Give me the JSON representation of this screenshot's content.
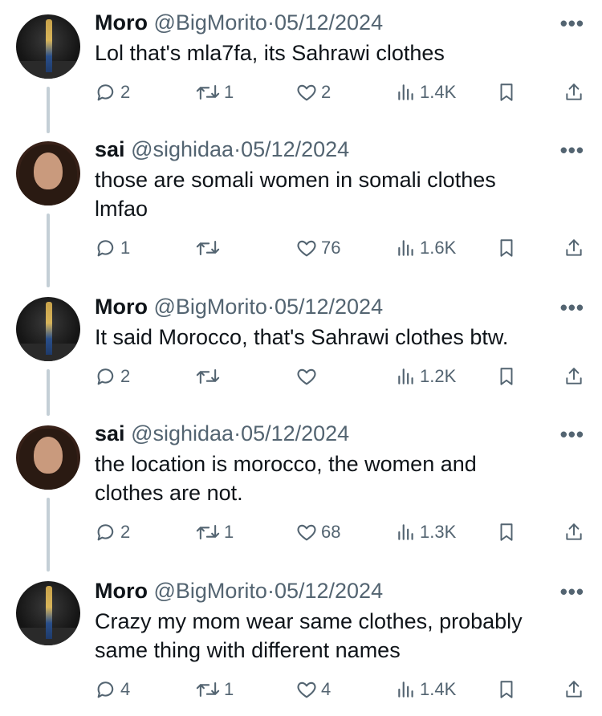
{
  "tweets": [
    {
      "name": "Moro",
      "handle": "@BigMorito",
      "dot": "·",
      "date": "05/12/2024",
      "text": "Lol that's mla7fa, its Sahrawi clothes",
      "replies": "2",
      "retweets": "1",
      "likes": "2",
      "views": "1.4K"
    },
    {
      "name": "sai",
      "handle": "@sighidaa",
      "dot": "·",
      "date": "05/12/2024",
      "text": "those are somali women in somali clothes lmfao",
      "replies": "1",
      "retweets": "",
      "likes": "76",
      "views": "1.6K"
    },
    {
      "name": "Moro",
      "handle": "@BigMorito",
      "dot": "·",
      "date": "05/12/2024",
      "text": "It said Morocco, that's Sahrawi clothes btw.",
      "replies": "2",
      "retweets": "",
      "likes": "",
      "views": "1.2K"
    },
    {
      "name": "sai",
      "handle": "@sighidaa",
      "dot": "·",
      "date": "05/12/2024",
      "text": "the location is morocco, the women and clothes are not.",
      "replies": "2",
      "retweets": "1",
      "likes": "68",
      "views": "1.3K"
    },
    {
      "name": "Moro",
      "handle": "@BigMorito",
      "dot": "·",
      "date": "05/12/2024",
      "text": "Crazy my mom wear same clothes, probably same thing with different names",
      "replies": "4",
      "retweets": "1",
      "likes": "4",
      "views": "1.4K"
    }
  ],
  "more_label": "•••",
  "icons": {
    "reply": "reply-icon",
    "retweet": "retweet-icon",
    "like": "heart-icon",
    "views": "views-icon",
    "bookmark": "bookmark-icon",
    "share": "share-icon"
  },
  "colors": {
    "text": "#0f1419",
    "muted": "#536471",
    "thread_line": "#c4cfd6"
  }
}
